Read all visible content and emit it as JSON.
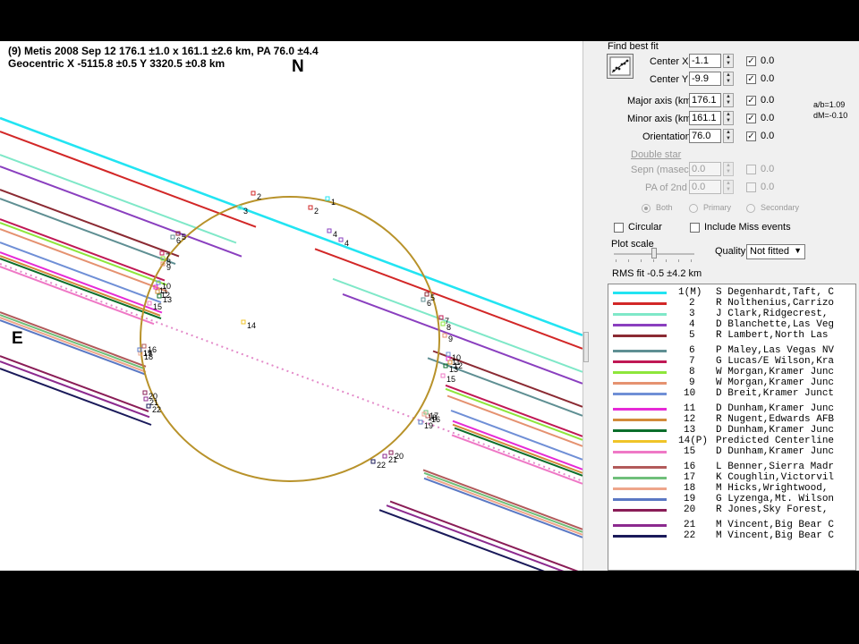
{
  "plot": {
    "title_line1": "(9) Metis  2008 Sep 12   176.1 ±1.0 x 161.1 ±2.6 km,  PA 76.0 ±4.4",
    "title_line2": "Geocentric  X  -5115.8 ±0.5  Y 3320.5 ±0.8 km",
    "north_label": "N",
    "east_label": "E",
    "ellipse_color": "#b8922a",
    "chord_numbers": [
      "1",
      "2",
      "3",
      "4",
      "5",
      "6",
      "7",
      "8",
      "9",
      "10",
      "11",
      "12",
      "13",
      "14",
      "15",
      "16",
      "17",
      "18",
      "19",
      "20",
      "21",
      "22"
    ]
  },
  "panel": {
    "find_best_fit_label": "Find best fit",
    "find_best_fit_icon": "scatter-fit-icon",
    "center_x": {
      "label": "Center X",
      "value": "-1.1",
      "uncertainty": "0.0"
    },
    "center_y": {
      "label": "Center Y",
      "value": "-9.9",
      "uncertainty": "0.0"
    },
    "major_axis": {
      "label": "Major axis (km)",
      "value": "176.1",
      "uncertainty": "0.0"
    },
    "minor_axis": {
      "label": "Minor axis (km)",
      "value": "161.1",
      "uncertainty": "0.0"
    },
    "orientation": {
      "label": "Orientation",
      "value": "76.0",
      "uncertainty": "0.0"
    },
    "ratio_text": "a/b=1.09",
    "dm_text": "dM=-0.10",
    "double_star_label": "Double star",
    "sepn": {
      "label": "Sepn (masec)",
      "value": "0.0",
      "uncertainty": "0.0"
    },
    "pa_2nd": {
      "label": "PA of 2nd",
      "value": "0.0",
      "uncertainty": "0.0"
    },
    "radio_both": "Both",
    "radio_primary": "Primary",
    "radio_secondary": "Secondary",
    "circular_label": "Circular",
    "include_miss_label": "Include Miss events",
    "plot_scale_label": "Plot scale",
    "quality_label": "Quality",
    "quality_value": "Not fitted",
    "rms_label": "RMS fit -0.5 ±4.2 km"
  },
  "legend": [
    {
      "id": "1(M)",
      "name": "S Degenhardt,Taft, C",
      "color": "#22e4f2"
    },
    {
      "id": "2",
      "name": "R Nolthenius,Carrizo",
      "color": "#d22727"
    },
    {
      "id": "3",
      "name": "J Clark,Ridgecrest, ",
      "color": "#7fe8c8"
    },
    {
      "id": "4",
      "name": "D Blanchette,Las Veg",
      "color": "#8a3fbf"
    },
    {
      "id": "5",
      "name": "R Lambert,North Las ",
      "color": "#8b2a33"
    },
    {
      "id": "6",
      "name": "P Maley,Las Vegas NV",
      "color": "#5f8f93"
    },
    {
      "id": "7",
      "name": "G Lucas/E Wilson,Kra",
      "color": "#c01855"
    },
    {
      "id": "8",
      "name": "W Morgan,Kramer Junc",
      "color": "#8ee63b"
    },
    {
      "id": "9",
      "name": "W Morgan,Kramer Junc",
      "color": "#e59270"
    },
    {
      "id": "10",
      "name": "D Breit,Kramer Junct",
      "color": "#6f8fd6"
    },
    {
      "id": "11",
      "name": "D Dunham,Kramer Junc",
      "color": "#e62ad6"
    },
    {
      "id": "12",
      "name": "R Nugent,Edwards AFB",
      "color": "#d38b3a"
    },
    {
      "id": "13",
      "name": "D Dunham,Kramer Junc",
      "color": "#0b6e2b"
    },
    {
      "id": "14(P)",
      "name": "Predicted Centerline",
      "color": "#f0c428"
    },
    {
      "id": "15",
      "name": "D Dunham,Kramer Junc",
      "color": "#ef78c6"
    },
    {
      "id": "16",
      "name": "L Benner,Sierra Madr",
      "color": "#b25a5a"
    },
    {
      "id": "17",
      "name": "K Coughlin,Victorvil",
      "color": "#6fbf7a"
    },
    {
      "id": "18",
      "name": "M Hicks,Wrightwood, ",
      "color": "#eea58a"
    },
    {
      "id": "19",
      "name": "G Lyzenga,Mt. Wilson",
      "color": "#5a78c4"
    },
    {
      "id": "20",
      "name": "R Jones,Sky Forest, ",
      "color": "#8a1d57"
    },
    {
      "id": "21",
      "name": "M Vincent,Big Bear C",
      "color": "#8c2a8f"
    },
    {
      "id": "22",
      "name": "M Vincent,Big Bear C",
      "color": "#1a1a5a"
    }
  ]
}
